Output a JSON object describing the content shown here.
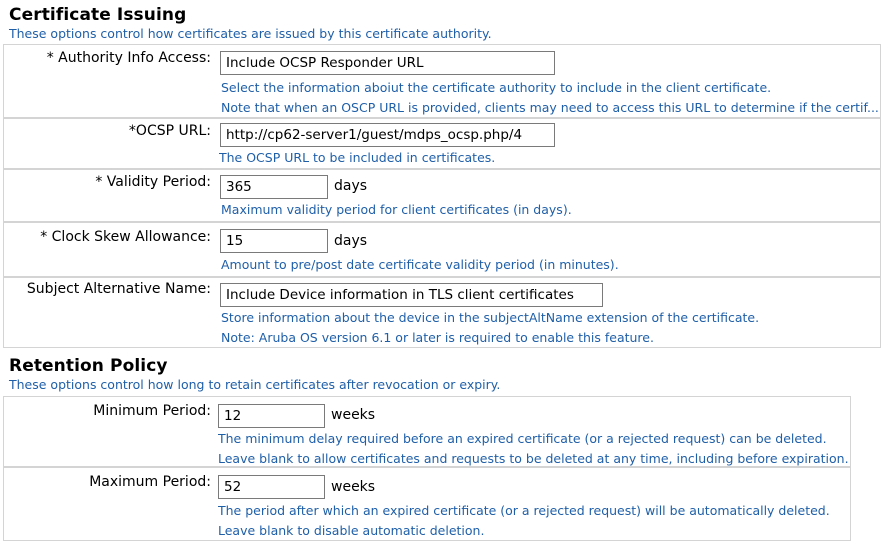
{
  "issuing": {
    "title": "Certificate Issuing",
    "description": "These options control how certificates are issued by this certificate authority.",
    "authority": {
      "label": "* Authority Info Access:",
      "value": "Include OCSP Responder URL",
      "hint1": "Select the information aboiut the certificate authority to include in the client certificate.",
      "hint2": "Note that when an OSCP URL is provided, clients may need to access this URL to determine if the certif..."
    },
    "ocsp": {
      "label": "*OCSP URL:",
      "value": "http://cp62-server1/guest/mdps_ocsp.php/4",
      "hint1": "The OCSP URL to be included in certificates."
    },
    "validity": {
      "label": "* Validity Period:",
      "value": "365",
      "unit": "days",
      "hint1": "Maximum validity period for client certificates (in days)."
    },
    "skew": {
      "label": "* Clock Skew Allowance:",
      "value": "15",
      "unit": "days",
      "hint1": "Amount to pre/post date certificate validity period (in minutes)."
    },
    "san": {
      "label": "Subject Alternative Name:",
      "value": "Include Device information in TLS client certificates",
      "hint1": "Store information about the device in the subjectAltName extension of the certificate.",
      "hint2": "Note: Aruba OS version 6.1 or later is required to enable this feature."
    }
  },
  "retention": {
    "title": "Retention Policy",
    "description": "These options control how long to retain certificates after revocation or expiry.",
    "minimum": {
      "label": "Minimum Period:",
      "value": "12",
      "unit": "weeks",
      "hint1": "The minimum delay required before an expired certificate (or a rejected request) can be deleted.",
      "hint2": "Leave blank to allow certificates and requests to be deleted at any time, including before expiration."
    },
    "maximum": {
      "label": "Maximum Period:",
      "value": "52",
      "unit": "weeks",
      "hint1": "The period after which an expired certificate (or a rejected request) will be automatically deleted.",
      "hint2": "Leave blank to disable automatic deletion."
    }
  }
}
